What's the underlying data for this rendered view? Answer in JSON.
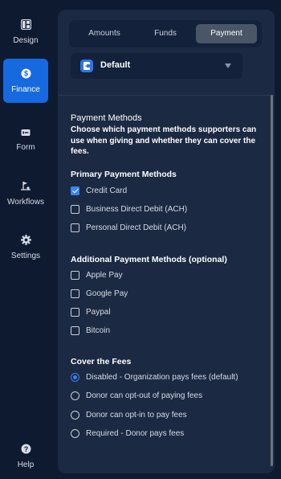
{
  "sidebar": {
    "items": [
      {
        "label": "Design",
        "icon": "layout-icon"
      },
      {
        "label": "Finance",
        "icon": "dollar-circle-icon"
      },
      {
        "label": "Form",
        "icon": "form-icon"
      },
      {
        "label": "Workflows",
        "icon": "workflow-icon"
      },
      {
        "label": "Settings",
        "icon": "gear-icon"
      }
    ],
    "help": {
      "label": "Help",
      "icon": "question-circle-icon"
    }
  },
  "tabs": [
    "Amounts",
    "Funds",
    "Payment"
  ],
  "active_tab": "Payment",
  "dropdown": {
    "value": "Default"
  },
  "section": {
    "title": "Payment Methods",
    "description": "Choose which payment methods supporters can use when giving and whether they can cover the fees."
  },
  "primary": {
    "title": "Primary Payment Methods",
    "options": [
      {
        "label": "Credit Card",
        "checked": true
      },
      {
        "label": "Business Direct Debit (ACH)",
        "checked": false
      },
      {
        "label": "Personal Direct Debit (ACH)",
        "checked": false
      }
    ]
  },
  "additional": {
    "title": "Additional Payment Methods (optional)",
    "options": [
      {
        "label": "Apple Pay",
        "checked": false
      },
      {
        "label": "Google Pay",
        "checked": false
      },
      {
        "label": "Paypal",
        "checked": false
      },
      {
        "label": "Bitcoin",
        "checked": false
      }
    ]
  },
  "fees": {
    "title": "Cover the Fees",
    "options": [
      {
        "label": "Disabled - Organization pays fees (default)",
        "selected": true
      },
      {
        "label": "Donor can opt-out of paying fees",
        "selected": false
      },
      {
        "label": "Donor can opt-in to pay fees",
        "selected": false
      },
      {
        "label": "Required - Donor pays fees",
        "selected": false
      }
    ]
  },
  "colors": {
    "accent": "#1769e0",
    "background": "#0e1a30",
    "panel": "#1b2942"
  }
}
